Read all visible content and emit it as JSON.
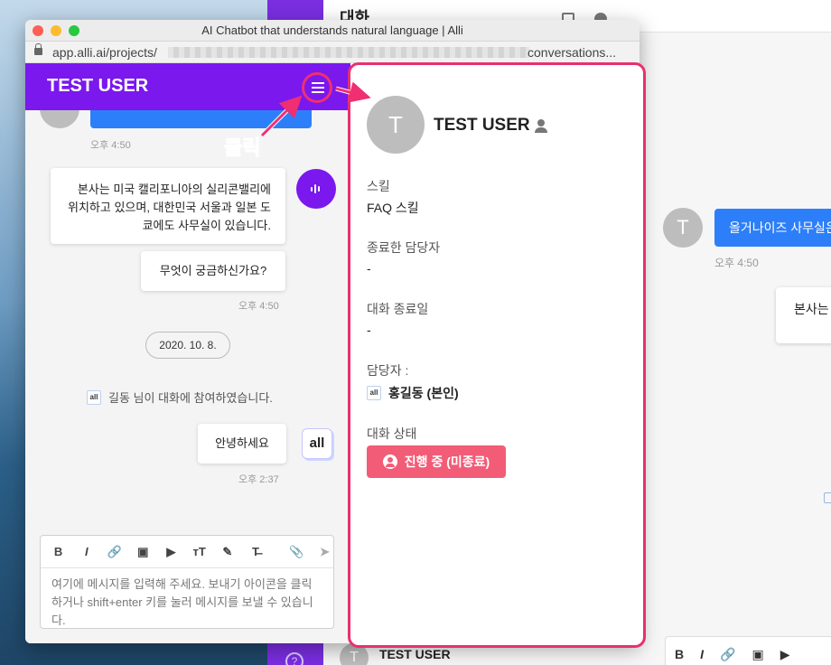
{
  "window": {
    "title": "AI Chatbot that understands natural language | Alli"
  },
  "url": {
    "start": "app.alli.ai/projects/",
    "end": "conversations..."
  },
  "header": {
    "title": "TEST USER"
  },
  "chat": {
    "time_1": "오후 4:50",
    "bot_message_1": "본사는 미국 캘리포니아의 실리콘밸리에 위치하고 있으며, 대한민국 서울과 일본 도쿄에도 사무실이 있습니다.",
    "bot_message_2": "무엇이 궁금하신가요?",
    "time_2": "오후 4:50",
    "date_chip": "2020. 10. 8.",
    "join_notice": "길동 님이 대화에 참여하였습니다.",
    "agent_message": "안녕하세요",
    "agent_logo_text": "all",
    "time_3": "오후 2:37"
  },
  "composer": {
    "tools": [
      "B",
      "I",
      "🔗",
      "▣",
      "▶",
      "тT",
      "✎",
      "T̶",
      "📎",
      "➤"
    ],
    "placeholder": "여기에 메시지를 입력해 주세요. 보내기 아이콘을 클릭하거나 shift+enter 키를 눌러 메시지를 보낼 수 있습니다."
  },
  "detail": {
    "avatar_letter": "T",
    "name": "TEST USER",
    "skill_label": "스킬",
    "skill_value": "FAQ 스킬",
    "ended_agent_label": "종료한 담당자",
    "ended_agent_value": "-",
    "end_date_label": "대화 종료일",
    "end_date_value": "-",
    "manager_label": "담당자 :",
    "manager_value": "홍길동 (본인)",
    "status_label": "대화 상태",
    "status_value": "진행 중 (미종료)"
  },
  "annotation": {
    "click_label": "클릭"
  },
  "background": {
    "topbar_title": "대화",
    "avatar_letter": "T",
    "blue_message": "올거나이즈 사무실은",
    "time": "오후 4:50",
    "white_message": "본사는",
    "bottom_name": "TEST USER",
    "bottom_avatar_letter": "T",
    "help": "?",
    "toolbar": [
      "B",
      "I",
      "🔗",
      "▣",
      "▶"
    ]
  },
  "colors": {
    "purple": "#7a18ee",
    "highlight_pink": "#e8306f",
    "status_pink": "#f25c77",
    "blue": "#2d7ff9"
  }
}
